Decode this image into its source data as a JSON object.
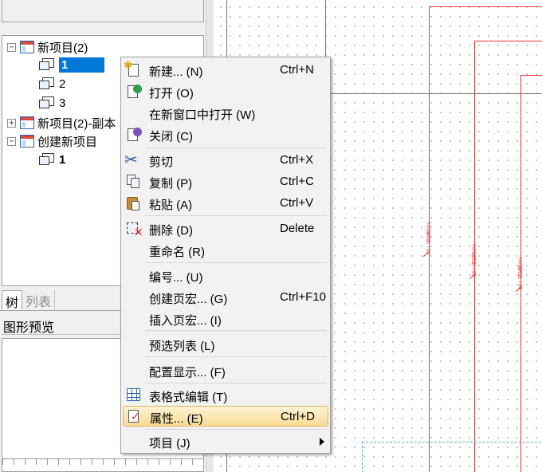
{
  "tree": {
    "items": [
      {
        "label": "新项目(2)",
        "expander": "−"
      },
      {
        "label": "1"
      },
      {
        "label": "2"
      },
      {
        "label": "3"
      },
      {
        "label": "新项目(2)-副本",
        "expander": "+"
      },
      {
        "label": "创建新项目",
        "expander": "−"
      },
      {
        "label": "1"
      }
    ]
  },
  "tabs": {
    "tree": "树",
    "list": "列表"
  },
  "preview": {
    "title": "图形预览"
  },
  "drawing": {
    "vertical_label": "00一般配置/01"
  },
  "context_menu": {
    "items": [
      {
        "label": "新建... (N)",
        "shortcut": "Ctrl+N",
        "icon": "new-document-icon"
      },
      {
        "label": "打开 (O)",
        "shortcut": "",
        "icon": "open-icon"
      },
      {
        "label": "在新窗口中打开 (W)",
        "shortcut": ""
      },
      {
        "label": "关闭 (C)",
        "shortcut": "",
        "icon": "close-document-icon"
      },
      {
        "label": "剪切",
        "shortcut": "Ctrl+X",
        "icon": "scissors-icon"
      },
      {
        "label": "复制 (P)",
        "shortcut": "Ctrl+C",
        "icon": "copy-icon"
      },
      {
        "label": "粘贴 (A)",
        "shortcut": "Ctrl+V",
        "icon": "paste-icon"
      },
      {
        "label": "删除 (D)",
        "shortcut": "Delete",
        "icon": "delete-icon"
      },
      {
        "label": "重命名 (R)",
        "shortcut": ""
      },
      {
        "label": "编号... (U)",
        "shortcut": ""
      },
      {
        "label": "创建页宏... (G)",
        "shortcut": "Ctrl+F10"
      },
      {
        "label": "插入页宏... (I)",
        "shortcut": ""
      },
      {
        "label": "预选列表 (L)",
        "shortcut": ""
      },
      {
        "label": "配置显示... (F)",
        "shortcut": ""
      },
      {
        "label": "表格式编辑 (T)",
        "shortcut": "",
        "icon": "table-icon"
      },
      {
        "label": "属性... (E)",
        "shortcut": "Ctrl+D",
        "icon": "properties-icon",
        "highlighted": true
      },
      {
        "label": "项目 (J)",
        "shortcut": "",
        "submenu": true
      }
    ]
  }
}
